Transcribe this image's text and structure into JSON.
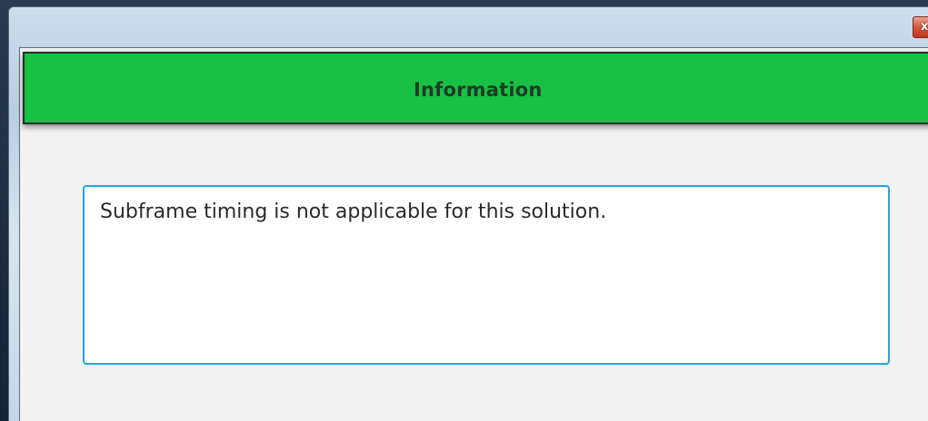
{
  "window": {
    "close_glyph": "x",
    "close_icon": "close-icon"
  },
  "header": {
    "title": "Information",
    "color": "#18c143"
  },
  "message": {
    "text": "Subframe timing is not applicable for this solution.",
    "border_color": "#29a3e0"
  }
}
